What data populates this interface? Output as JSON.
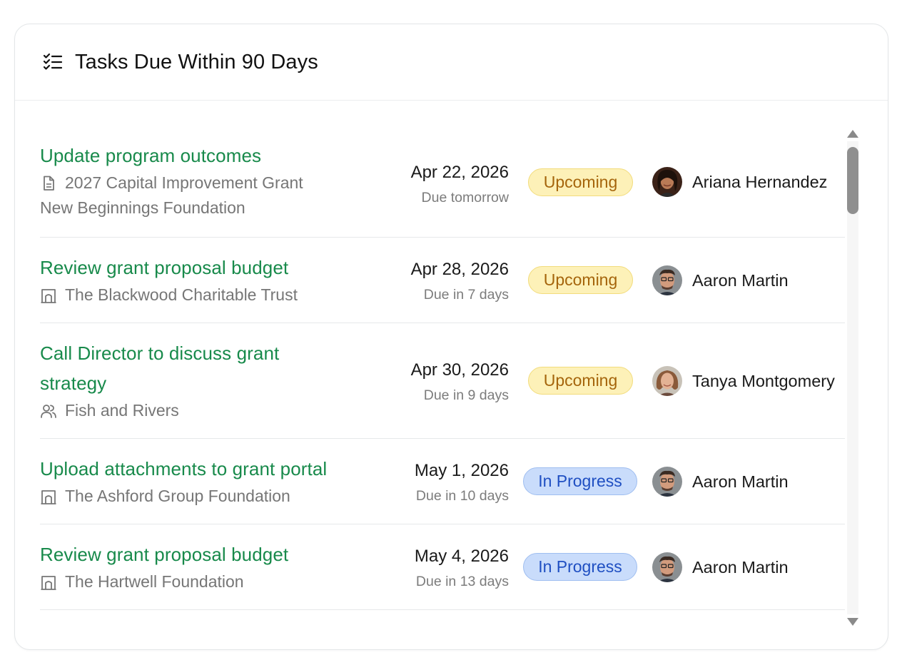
{
  "header": {
    "title": "Tasks Due Within 90 Days",
    "icon": "checklist-icon"
  },
  "colors": {
    "title_green": "#188a4b",
    "upcoming_bg": "#fdf1b8",
    "upcoming_text": "#a5650c",
    "inprogress_bg": "#c9dcfb",
    "inprogress_text": "#1f4fc2"
  },
  "tasks": [
    {
      "title": "Update program outcomes",
      "subtitle": "2027 Capital Improvement Grant",
      "subtitle_icon": "document-icon",
      "subtitle2": "New Beginnings Foundation",
      "date": "Apr 22, 2026",
      "due": "Due tomorrow",
      "status": "Upcoming",
      "assignee": "Ariana Hernandez"
    },
    {
      "title": "Review grant proposal budget",
      "subtitle": "The Blackwood Charitable Trust",
      "subtitle_icon": "building-icon",
      "date": "Apr 28, 2026",
      "due": "Due in 7 days",
      "status": "Upcoming",
      "assignee": "Aaron Martin"
    },
    {
      "title_line1": "Call Director to discuss grant",
      "title_line2": "strategy",
      "subtitle": "Fish and Rivers",
      "subtitle_icon": "people-icon",
      "date": "Apr 30, 2026",
      "due": "Due in 9 days",
      "status": "Upcoming",
      "assignee": "Tanya Montgomery"
    },
    {
      "title": "Upload attachments to grant portal",
      "subtitle": "The Ashford Group Foundation",
      "subtitle_icon": "building-icon",
      "date": "May 1, 2026",
      "due": "Due in 10 days",
      "status": "In Progress",
      "assignee": "Aaron Martin"
    },
    {
      "title": "Review grant proposal budget",
      "subtitle": "The Hartwell Foundation",
      "subtitle_icon": "building-icon",
      "date": "May 4, 2026",
      "due": "Due in 13 days",
      "status": "In Progress",
      "assignee": "Aaron Martin"
    }
  ]
}
